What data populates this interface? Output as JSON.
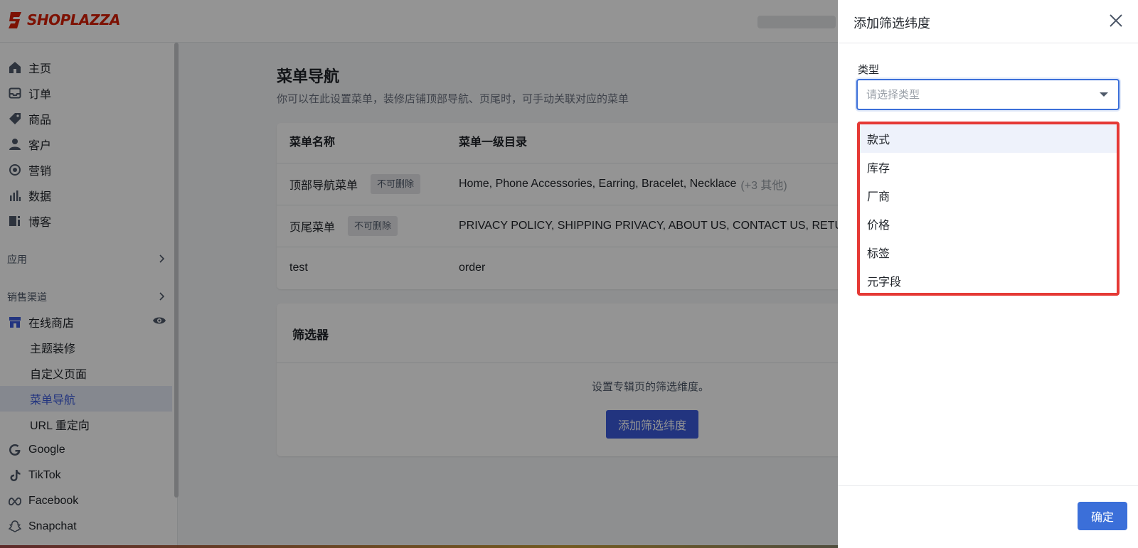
{
  "brand": {
    "name": "SHOPLAZZA",
    "color": "#d81e06"
  },
  "sidebar": {
    "items": [
      {
        "label": "主页",
        "icon": "home-icon"
      },
      {
        "label": "订单",
        "icon": "inbox-icon"
      },
      {
        "label": "商品",
        "icon": "tag-icon"
      },
      {
        "label": "客户",
        "icon": "user-icon"
      },
      {
        "label": "营销",
        "icon": "target-icon"
      },
      {
        "label": "数据",
        "icon": "bar-chart-icon"
      },
      {
        "label": "博客",
        "icon": "blog-icon"
      }
    ],
    "apps_label": "应用",
    "channels_label": "销售渠道",
    "online_store": {
      "label": "在线商店",
      "icon": "store-icon"
    },
    "sub_items": [
      "主题装修",
      "自定义页面",
      "菜单导航",
      "URL 重定向"
    ],
    "active_sub": "菜单导航",
    "channels": [
      {
        "label": "Google",
        "icon": "google-icon"
      },
      {
        "label": "TikTok",
        "icon": "tiktok-icon"
      },
      {
        "label": "Facebook",
        "icon": "meta-icon"
      },
      {
        "label": "Snapchat",
        "icon": "snapchat-icon"
      }
    ]
  },
  "main": {
    "title": "菜单导航",
    "description": "你可以在此设置菜单，装修店铺顶部导航、页尾时，可手动关联对应的菜单",
    "table": {
      "headers": [
        "菜单名称",
        "菜单一级目录"
      ],
      "rows": [
        {
          "name": "顶部导航菜单",
          "tag": "不可删除",
          "items": "Home, Phone Accessories, Earring, Bracelet, Necklace",
          "extra": "(+3 其他)"
        },
        {
          "name": "页尾菜单",
          "tag": "不可删除",
          "items": "PRIVACY POLICY, SHIPPING PRIVACY, ABOUT US, CONTACT US, RETURN",
          "extra": ""
        },
        {
          "name": "test",
          "tag": "",
          "items": "order",
          "extra": ""
        }
      ]
    },
    "filter": {
      "title": "筛选器",
      "description": "设置专辑页的筛选维度。",
      "button": "添加筛选纬度"
    }
  },
  "drawer": {
    "title": "添加筛选纬度",
    "field_label": "类型",
    "select_placeholder": "请选择类型",
    "options": [
      "款式",
      "库存",
      "厂商",
      "价格",
      "标签",
      "元字段"
    ],
    "highlight_color": "#e53935",
    "confirm": "确定"
  }
}
